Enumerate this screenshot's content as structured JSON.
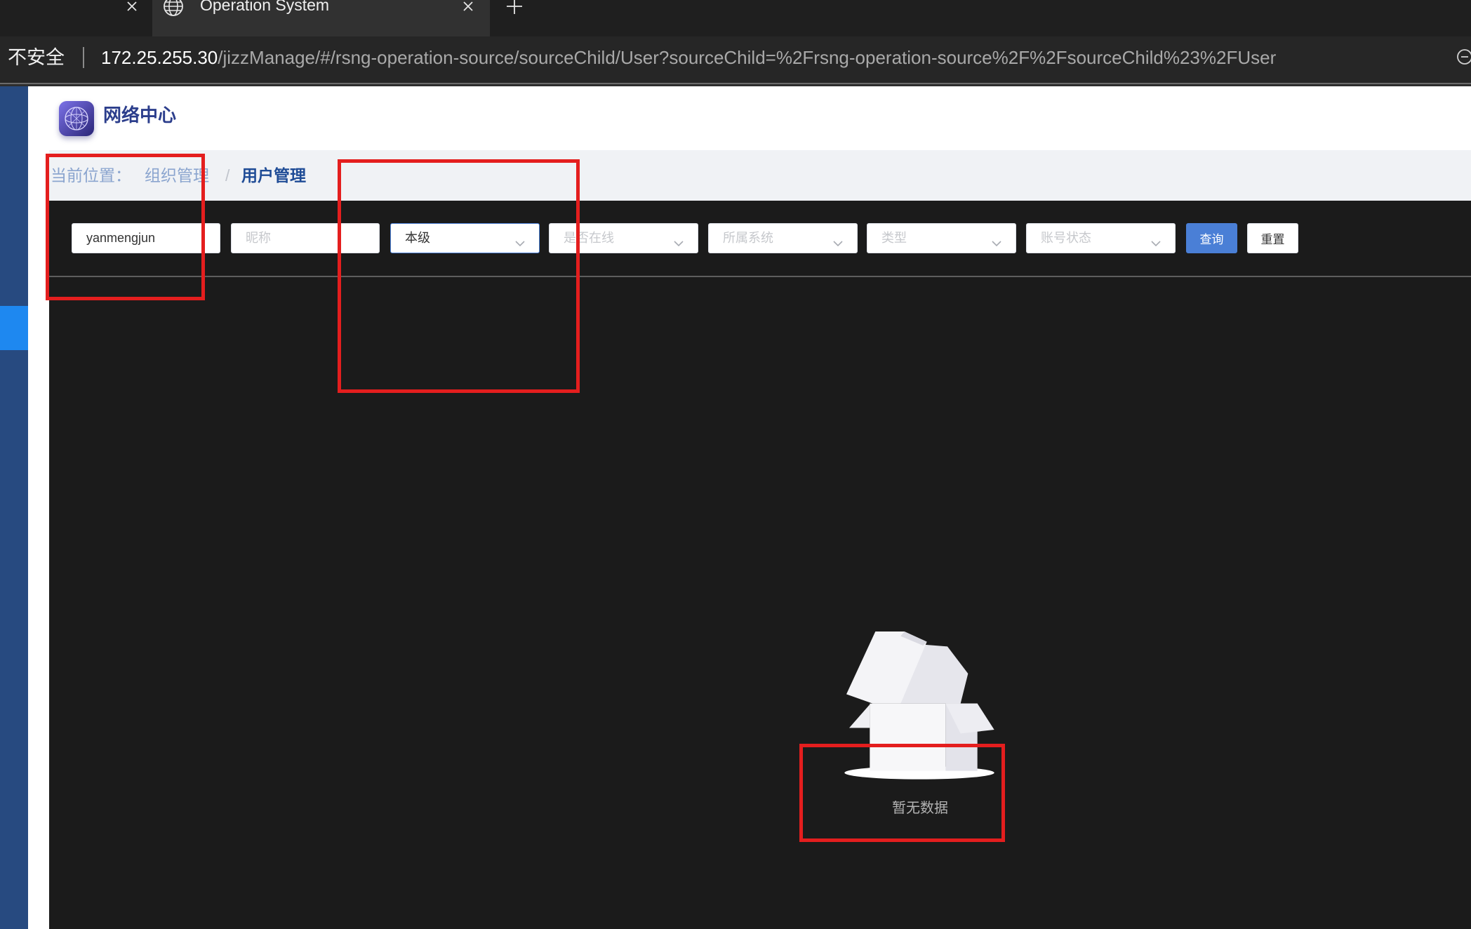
{
  "browser": {
    "active_tab": "Operation System",
    "security_label": "不安全",
    "url_host": "172.25.255.30",
    "url_path": "/jizzManage/#/rsng-operation-source/sourceChild/User?sourceChild=%2Frsng-operation-source%2F%2FsourceChild%23%2FUser"
  },
  "header": {
    "brand": "网络中心"
  },
  "breadcrumb": {
    "prefix": "当前位置：",
    "separator": "/",
    "items": [
      "组织管理",
      "用户管理"
    ]
  },
  "filters": {
    "username": {
      "value": "yanmengjun"
    },
    "nickname": {
      "placeholder": "昵称"
    },
    "level": {
      "value": "本级"
    },
    "online": {
      "placeholder": "是否在线"
    },
    "system": {
      "placeholder": "所属系统"
    },
    "type": {
      "placeholder": "类型"
    },
    "status": {
      "placeholder": "账号状态"
    }
  },
  "buttons": {
    "query": "查询",
    "reset": "重置"
  },
  "empty_state": {
    "text": "暂无数据"
  },
  "icons": {
    "tab": "globe-icon",
    "tab_close": "close-icon",
    "new_tab": "plus-icon",
    "zoom": "zoom-out-icon",
    "select": "chevron-down-icon",
    "logo": "globe-mesh-logo",
    "empty": "empty-box-icon"
  },
  "colors": {
    "accent": "#4a7fd6",
    "sidebar": "#274a80",
    "sidebar_active": "#1e88f0",
    "brand_text": "#2c3e8c",
    "breadcrumb_current": "#1f4c96",
    "annotation": "#e41e1e"
  }
}
